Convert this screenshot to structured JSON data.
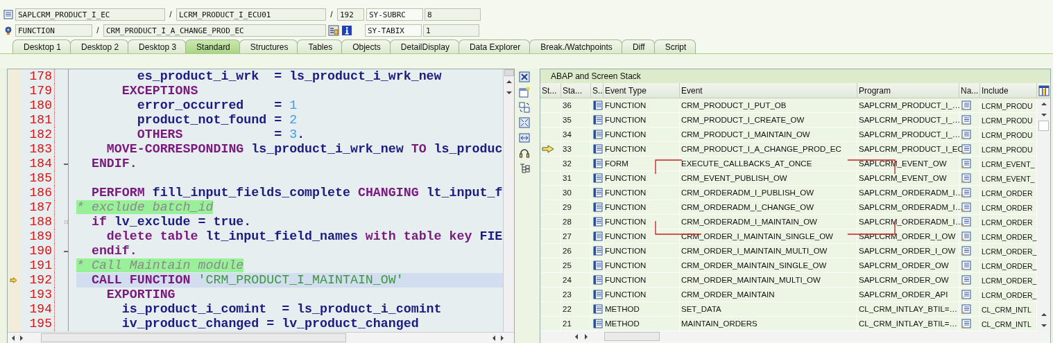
{
  "header": {
    "program": "SAPLCRM_PRODUCT_I_EC",
    "include": "LCRM_PRODUCT_I_ECU01",
    "line": "192",
    "event_type": "FUNCTION",
    "event": "CRM_PRODUCT_I_A_CHANGE_PROD_EC",
    "separators": [
      "/",
      "/",
      "/"
    ],
    "sysvars": [
      {
        "name": "SY-SUBRC",
        "value": "8"
      },
      {
        "name": "SY-TABIX",
        "value": "1"
      }
    ]
  },
  "tabs": [
    {
      "label": "Desktop 1",
      "selected": false
    },
    {
      "label": "Desktop 2",
      "selected": false
    },
    {
      "label": "Desktop 3",
      "selected": false
    },
    {
      "label": "Standard",
      "selected": true
    },
    {
      "label": "Structures",
      "selected": false
    },
    {
      "label": "Tables",
      "selected": false
    },
    {
      "label": "Objects",
      "selected": false
    },
    {
      "label": "DetailDisplay",
      "selected": false
    },
    {
      "label": "Data Explorer",
      "selected": false
    },
    {
      "label": "Break./Watchpoints",
      "selected": false
    },
    {
      "label": "Diff",
      "selected": false
    },
    {
      "label": "Script",
      "selected": false
    }
  ],
  "code": {
    "lines": [
      {
        "number": "178",
        "current": false,
        "collapsible": false,
        "block_end": false,
        "segments": [
          {
            "kind": "ident",
            "text": "        es_product_i_wrk  = ls_product_i_wrk_new"
          }
        ]
      },
      {
        "number": "179",
        "current": false,
        "collapsible": false,
        "block_end": false,
        "segments": [
          {
            "kind": "keyword",
            "text": "      EXCEPTIONS"
          }
        ]
      },
      {
        "number": "180",
        "current": false,
        "collapsible": false,
        "block_end": false,
        "segments": [
          {
            "kind": "ident",
            "text": "        error_occurred    = "
          },
          {
            "kind": "number",
            "text": "1"
          }
        ]
      },
      {
        "number": "181",
        "current": false,
        "collapsible": false,
        "block_end": false,
        "segments": [
          {
            "kind": "ident",
            "text": "        product_not_found = "
          },
          {
            "kind": "number",
            "text": "2"
          }
        ]
      },
      {
        "number": "182",
        "current": false,
        "collapsible": false,
        "block_end": false,
        "segments": [
          {
            "kind": "keyword",
            "text": "        OTHERS"
          },
          {
            "kind": "ident",
            "text": "            = "
          },
          {
            "kind": "number",
            "text": "3"
          },
          {
            "kind": "ident",
            "text": "."
          }
        ]
      },
      {
        "number": "183",
        "current": false,
        "collapsible": false,
        "block_end": false,
        "segments": [
          {
            "kind": "keyword",
            "text": "    MOVE-CORRESPONDING"
          },
          {
            "kind": "ident",
            "text": " ls_product_i_wrk_new "
          },
          {
            "kind": "keyword",
            "text": "TO"
          },
          {
            "kind": "ident",
            "text": " ls_produc"
          }
        ]
      },
      {
        "number": "184",
        "current": false,
        "collapsible": false,
        "block_end": true,
        "segments": [
          {
            "kind": "keyword",
            "text": "  ENDIF."
          }
        ]
      },
      {
        "number": "185",
        "current": false,
        "collapsible": false,
        "block_end": false
      },
      {
        "number": "186",
        "current": false,
        "collapsible": false,
        "block_end": false,
        "segments": [
          {
            "kind": "keyword",
            "text": "  PERFORM"
          },
          {
            "kind": "ident",
            "text": " fill_input_fields_complete "
          },
          {
            "kind": "keyword",
            "text": "CHANGING"
          },
          {
            "kind": "ident",
            "text": " lt_input_f"
          }
        ]
      },
      {
        "number": "187",
        "current": false,
        "collapsible": false,
        "block_end": false,
        "segments": [
          {
            "kind": "comment",
            "text": "* exclude batch_id"
          }
        ]
      },
      {
        "number": "188",
        "current": false,
        "collapsible": true,
        "block_end": false,
        "segments": [
          {
            "kind": "keyword",
            "text": "  if"
          },
          {
            "kind": "ident",
            "text": " lv_exclude = true."
          }
        ]
      },
      {
        "number": "189",
        "current": false,
        "collapsible": false,
        "block_end": false,
        "segments": [
          {
            "kind": "keyword",
            "text": "    delete table"
          },
          {
            "kind": "ident",
            "text": " lt_input_field_names "
          },
          {
            "kind": "keyword",
            "text": "with table key"
          },
          {
            "kind": "ident",
            "text": " FIE"
          }
        ]
      },
      {
        "number": "190",
        "current": false,
        "collapsible": false,
        "block_end": true,
        "segments": [
          {
            "kind": "keyword",
            "text": "  endif."
          }
        ]
      },
      {
        "number": "191",
        "current": false,
        "collapsible": false,
        "block_end": false,
        "segments": [
          {
            "kind": "comment",
            "text": "* Call Maintain module"
          }
        ]
      },
      {
        "number": "192",
        "current": true,
        "collapsible": false,
        "block_end": false,
        "segments": [
          {
            "kind": "keyword",
            "text": "  CALL FUNCTION"
          },
          {
            "kind": "string",
            "text": " 'CRM_PRODUCT_I_MAINTAIN_OW'"
          }
        ]
      },
      {
        "number": "193",
        "current": false,
        "collapsible": false,
        "block_end": false,
        "segments": [
          {
            "kind": "keyword",
            "text": "    EXPORTING"
          }
        ]
      },
      {
        "number": "194",
        "current": false,
        "collapsible": false,
        "block_end": false,
        "segments": [
          {
            "kind": "ident",
            "text": "      is_product_i_comint  = ls_product_i_comint"
          }
        ]
      },
      {
        "number": "195",
        "current": false,
        "collapsible": false,
        "block_end": false,
        "segments": [
          {
            "kind": "ident",
            "text": "      iv_product_changed = lv_product_changed"
          }
        ]
      }
    ]
  },
  "stack": {
    "title": "ABAP and Screen Stack",
    "columns": [
      "St...",
      "Sta...",
      "S..",
      "Event Type",
      "Event",
      "Program",
      "Na...",
      "Include"
    ],
    "rows": [
      {
        "current": false,
        "level": "36",
        "event_type": "FUNCTION",
        "event": "CRM_PRODUCT_I_PUT_OB",
        "program": "SAPLCRM_PRODUCT_I_…",
        "include": "LCRM_PRODU"
      },
      {
        "current": false,
        "level": "35",
        "event_type": "FUNCTION",
        "event": "CRM_PRODUCT_I_CREATE_OW",
        "program": "SAPLCRM_PRODUCT_I_…",
        "include": "LCRM_PRODU"
      },
      {
        "current": false,
        "level": "34",
        "event_type": "FUNCTION",
        "event": "CRM_PRODUCT_I_MAINTAIN_OW",
        "program": "SAPLCRM_PRODUCT_I_…",
        "include": "LCRM_PRODU"
      },
      {
        "current": true,
        "level": "33",
        "event_type": "FUNCTION",
        "event": "CRM_PRODUCT_I_A_CHANGE_PROD_EC",
        "program": "SAPLCRM_PRODUCT_I_EC",
        "include": "LCRM_PRODU"
      },
      {
        "current": false,
        "level": "32",
        "event_type": "FORM",
        "event": "EXECUTE_CALLBACKS_AT_ONCE",
        "program": "SAPLCRM_EVENT_OW",
        "include": "LCRM_EVENT_"
      },
      {
        "current": false,
        "level": "31",
        "event_type": "FUNCTION",
        "event": "CRM_EVENT_PUBLISH_OW",
        "program": "SAPLCRM_EVENT_OW",
        "include": "LCRM_EVENT_"
      },
      {
        "current": false,
        "level": "30",
        "event_type": "FUNCTION",
        "event": "CRM_ORDERADM_I_PUBLISH_OW",
        "program": "SAPLCRM_ORDERADM_I…",
        "include": "LCRM_ORDER"
      },
      {
        "current": false,
        "level": "29",
        "event_type": "FUNCTION",
        "event": "CRM_ORDERADM_I_CHANGE_OW",
        "program": "SAPLCRM_ORDERADM_I…",
        "include": "LCRM_ORDER"
      },
      {
        "current": false,
        "level": "28",
        "event_type": "FUNCTION",
        "event": "CRM_ORDERADM_I_MAINTAIN_OW",
        "program": "SAPLCRM_ORDERADM_I…",
        "include": "LCRM_ORDER"
      },
      {
        "current": false,
        "level": "27",
        "event_type": "FUNCTION",
        "event": "CRM_ORDER_I_MAINTAIN_SINGLE_OW",
        "program": "SAPLCRM_ORDER_I_OW",
        "include": "LCRM_ORDER_"
      },
      {
        "current": false,
        "level": "26",
        "event_type": "FUNCTION",
        "event": "CRM_ORDER_I_MAINTAIN_MULTI_OW",
        "program": "SAPLCRM_ORDER_I_OW",
        "include": "LCRM_ORDER_"
      },
      {
        "current": false,
        "level": "25",
        "event_type": "FUNCTION",
        "event": "CRM_ORDER_MAINTAIN_SINGLE_OW",
        "program": "SAPLCRM_ORDER_OW",
        "include": "LCRM_ORDER_"
      },
      {
        "current": false,
        "level": "24",
        "event_type": "FUNCTION",
        "event": "CRM_ORDER_MAINTAIN_MULTI_OW",
        "program": "SAPLCRM_ORDER_OW",
        "include": "LCRM_ORDER_"
      },
      {
        "current": false,
        "level": "23",
        "event_type": "FUNCTION",
        "event": "CRM_ORDER_MAINTAIN",
        "program": "SAPLCRM_ORDER_API",
        "include": "LCRM_ORDER_"
      },
      {
        "current": false,
        "level": "22",
        "event_type": "METHOD",
        "event": "SET_DATA",
        "program": "CL_CRM_INTLAY_BTIL=…",
        "include": "CL_CRM_INTL"
      },
      {
        "current": false,
        "level": "21",
        "event_type": "METHOD",
        "event": "MAINTAIN_ORDERS",
        "program": "CL_CRM_INTLAY_BTIL=…",
        "include": "CL_CRM_INTL"
      }
    ]
  }
}
